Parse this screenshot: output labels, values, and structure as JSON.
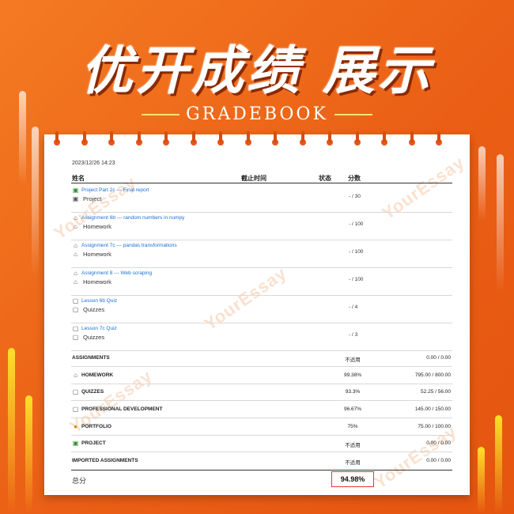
{
  "colors": {
    "background": "#ea5f15",
    "accent": "#1a6fd6",
    "highlight": "#e23b2c"
  },
  "banner": {
    "title_left": "优开成绩",
    "title_right": "展示",
    "subtitle": "GRADEBOOK"
  },
  "watermark": "YourEssay",
  "gradebook": {
    "timestamp": "2023/12/26 14:23",
    "columns": {
      "name": "姓名",
      "due": "截止时间",
      "status": "状态",
      "score": "分数"
    },
    "items": [
      {
        "title": "Project Part 2c --- Final report",
        "category": "Project",
        "icon": "project-icon",
        "score": "- / 30"
      },
      {
        "title": "Assignment 6b --- random numbers in numpy",
        "category": "Homework",
        "icon": "home-icon",
        "score": "- / 100"
      },
      {
        "title": "Assignment 7c --- pandas transformations",
        "category": "Homework",
        "icon": "home-icon",
        "score": "- / 100"
      },
      {
        "title": "Assignment 8 --- Web scraping",
        "category": "Homework",
        "icon": "home-icon",
        "score": "- / 100"
      },
      {
        "title": "Lesson 6b Quiz",
        "category": "Quizzes",
        "icon": "quiz-icon",
        "score": "- / 4"
      },
      {
        "title": "Lesson 7c Quiz",
        "category": "Quizzes",
        "icon": "quiz-icon",
        "score": "- / 3"
      }
    ],
    "summary": [
      {
        "label": "ASSIGNMENTS",
        "icon": "",
        "pct": "不适用",
        "points": "0.00 / 0.00"
      },
      {
        "label": "HOMEWORK",
        "icon": "home-icon",
        "pct": "99.38%",
        "points": "795.00 / 800.00"
      },
      {
        "label": "QUIZZES",
        "icon": "quiz-icon",
        "pct": "93.3%",
        "points": "52.25 / 56.00"
      },
      {
        "label": "PROFESSIONAL DEVELOPMENT",
        "icon": "quiz-icon",
        "pct": "96.67%",
        "points": "145.00 / 150.00"
      },
      {
        "label": "PORTFOLIO",
        "icon": "portfolio-icon",
        "pct": "75%",
        "points": "75.00 / 100.00"
      },
      {
        "label": "PROJECT",
        "icon": "project-icon",
        "pct": "不适用",
        "points": "0.00 / 0.00"
      },
      {
        "label": "IMPORTED ASSIGNMENTS",
        "icon": "",
        "pct": "不适用",
        "points": "0.00 / 0.00"
      }
    ],
    "total_label": "总分",
    "total_value": "94.98%"
  }
}
